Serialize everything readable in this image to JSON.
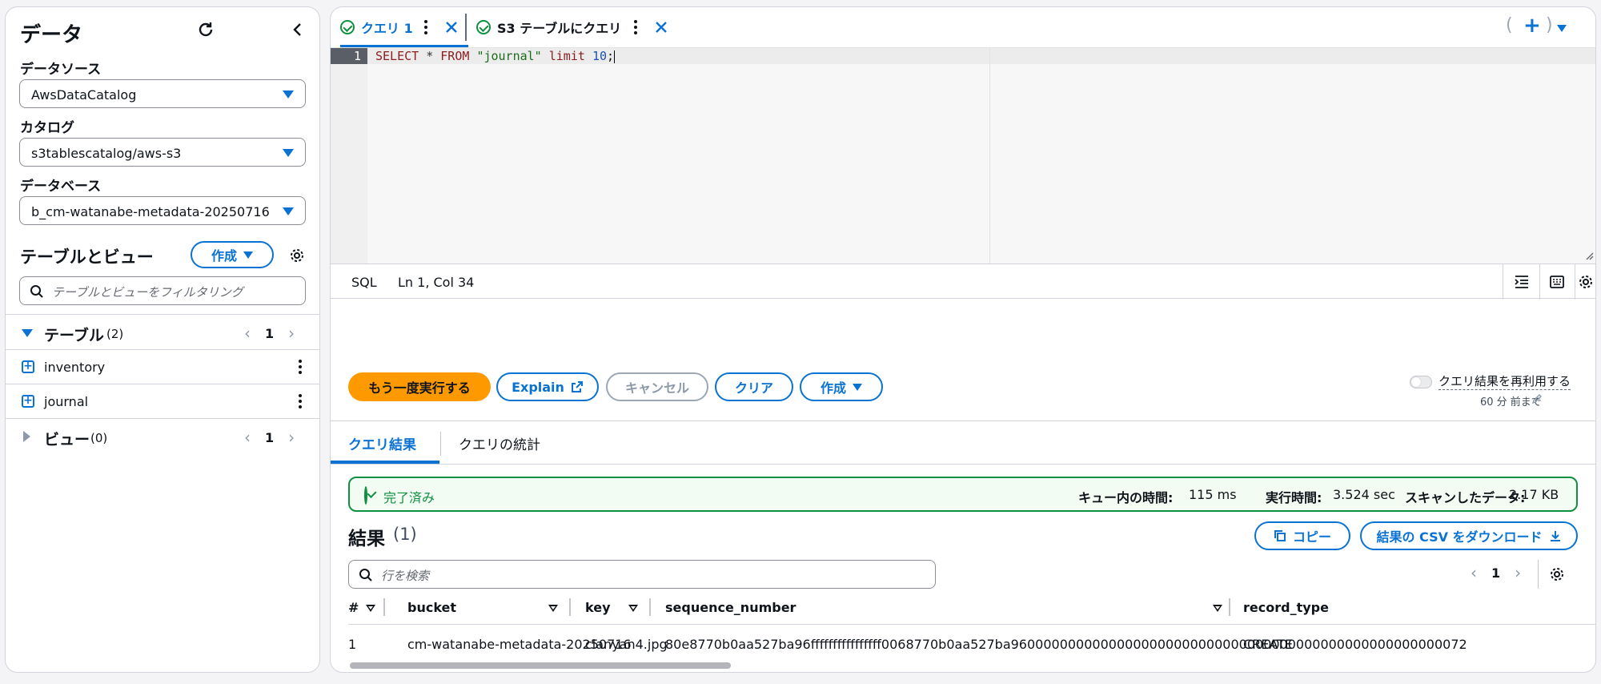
{
  "left": {
    "title": "データ",
    "datasource": {
      "label": "データソース",
      "value": "AwsDataCatalog"
    },
    "catalog": {
      "label": "カタログ",
      "value": "s3tablescatalog/aws-s3"
    },
    "database": {
      "label": "データベース",
      "value": "b_cm-watanabe-metadata-20250716"
    },
    "tables_views": {
      "title": "テーブルとビュー",
      "create_label": "作成",
      "filter_placeholder": "テーブルとビューをフィルタリング"
    },
    "tables": {
      "label": "テーブル",
      "count": "(2)",
      "page": "1",
      "items": [
        {
          "name": "inventory"
        },
        {
          "name": "journal"
        }
      ]
    },
    "views": {
      "label": "ビュー",
      "count": "(0)",
      "page": "1"
    }
  },
  "tabs": [
    {
      "label": "クエリ 1",
      "active": true
    },
    {
      "label": "S3 テーブルにクエリ",
      "active": false
    }
  ],
  "editor": {
    "line_number": "1",
    "code": {
      "kw1": "SELECT",
      "star": "*",
      "kw2": "FROM",
      "str": "\"journal\"",
      "kw3": "limit",
      "num": "10",
      "end": ";"
    },
    "language": "SQL",
    "position": "Ln 1, Col 34"
  },
  "actions": {
    "run_again": "もう一度実行する",
    "explain": "Explain",
    "cancel": "キャンセル",
    "clear": "クリア",
    "create": "作成",
    "reuse_label": "クエリ結果を再利用する",
    "reuse_sub": "60 分 前まで"
  },
  "result_tabs": [
    {
      "label": "クエリ結果"
    },
    {
      "label": "クエリの統計"
    }
  ],
  "status": {
    "text": "完了済み",
    "queue_label": "キュー内の時間:",
    "queue_value": "115 ms",
    "exec_label": "実行時間:",
    "exec_value": "3.524 sec",
    "scan_label": "スキャンしたデータ:",
    "scan_value": "2.17 KB"
  },
  "results": {
    "title": "結果",
    "count": "(1)",
    "copy": "コピー",
    "download": "結果の CSV をダウンロード",
    "search_placeholder": "行を検索",
    "page": "1",
    "columns": [
      "#",
      "bucket",
      "key",
      "sequence_number",
      "record_type"
    ],
    "rows": [
      {
        "n": "1",
        "bucket": "cm-watanabe-metadata-20250716",
        "key": "clanyan4.jpg",
        "sequence_number": "80e8770b0aa527ba96ffffffffffffffff0068770b0aa527ba96000000000000000000000000000000000000000000000000000072",
        "record_type": "CREATE"
      }
    ]
  },
  "colors": {
    "accent": "#0972d3",
    "primary": "#ff9900",
    "success": "#0f8f3f"
  }
}
